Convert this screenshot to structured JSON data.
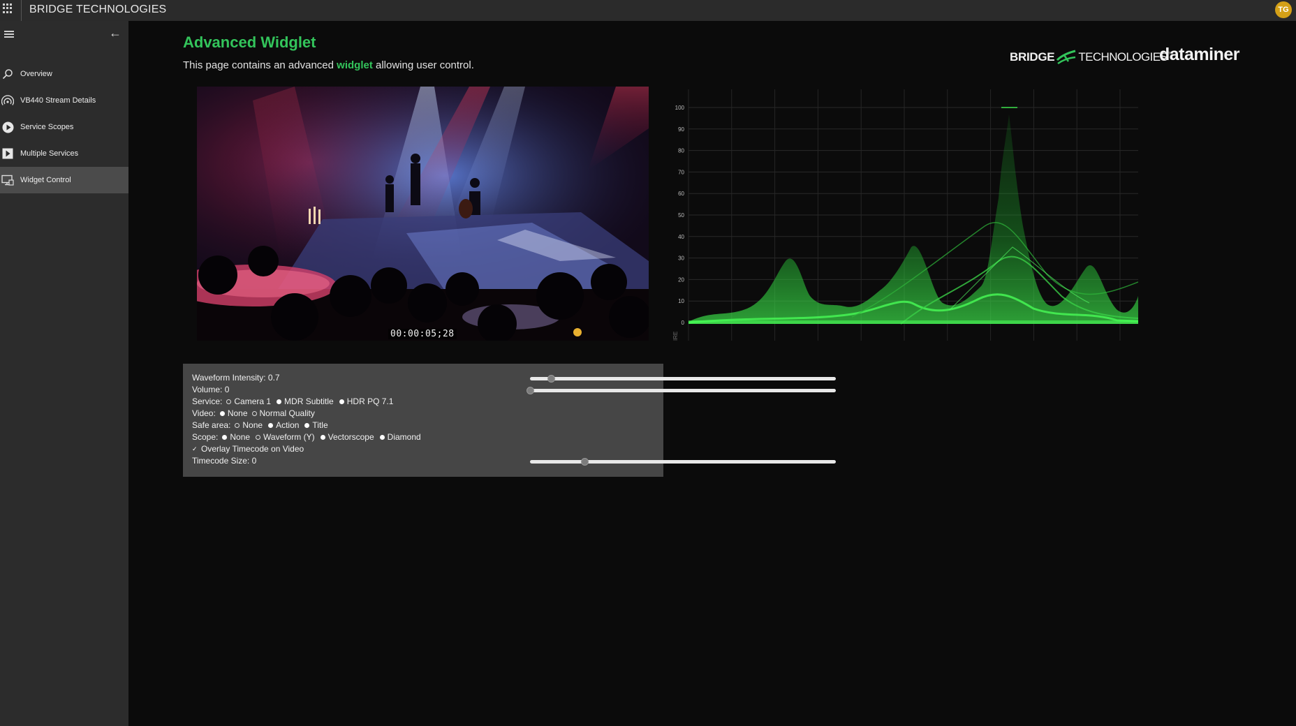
{
  "app": {
    "title": "BRIDGE TECHNOLOGIES",
    "user_initials": "TG"
  },
  "sidebar": {
    "items": [
      {
        "label": "Overview",
        "icon": "search-icon",
        "active": false
      },
      {
        "label": "VB440 Stream Details",
        "icon": "signal-icon",
        "active": false
      },
      {
        "label": "Service Scopes",
        "icon": "play-circle-icon",
        "active": false
      },
      {
        "label": "Multiple Services",
        "icon": "play-square-icon",
        "active": false
      },
      {
        "label": "Widget Control",
        "icon": "monitor-icon",
        "active": true
      }
    ]
  },
  "page": {
    "title": "Advanced Widglet",
    "desc_before": "This page contains an advanced ",
    "desc_highlight": "widglet",
    "desc_after": " allowing user control."
  },
  "logos": {
    "bridge_bold": "BRIDGE",
    "bridge_light": "TECHNOLOGIES",
    "bridge_tm": "™",
    "dataminer": "dataminer"
  },
  "video": {
    "timecode": "00:00:05;28"
  },
  "scope": {
    "y_ticks": [
      "100",
      "90",
      "80",
      "70",
      "60",
      "50",
      "40",
      "30",
      "20",
      "10",
      "0"
    ],
    "corner_label": "IRE",
    "trace_color": "#2fd13c"
  },
  "controls": {
    "waveform_intensity": {
      "label": "Waveform Intensity: 0.7",
      "value": 0.07
    },
    "volume": {
      "label": "Volume: 0",
      "value": 0
    },
    "service": {
      "label": "Service:",
      "options": [
        "Camera 1",
        "MDR Subtitle",
        "HDR PQ 7.1"
      ],
      "selected": 1
    },
    "video": {
      "label": "Video:",
      "options": [
        "None",
        "Normal Quality"
      ],
      "selected": 0
    },
    "safe_area": {
      "label": "Safe area:",
      "options": [
        "None",
        "Action",
        "Title"
      ],
      "selected": 2
    },
    "scope": {
      "label": "Scope:",
      "options": [
        "None",
        "Waveform (Y)",
        "Vectorscope",
        "Diamond"
      ],
      "selected": 3
    },
    "overlay_timecode": {
      "label": "Overlay Timecode on Video",
      "checked": true
    },
    "timecode_size": {
      "label": "Timecode Size: 0",
      "value": 0.18
    }
  },
  "colors": {
    "accent": "#33c45b",
    "panel": "#464646",
    "sidebar": "#2c2c2c"
  }
}
